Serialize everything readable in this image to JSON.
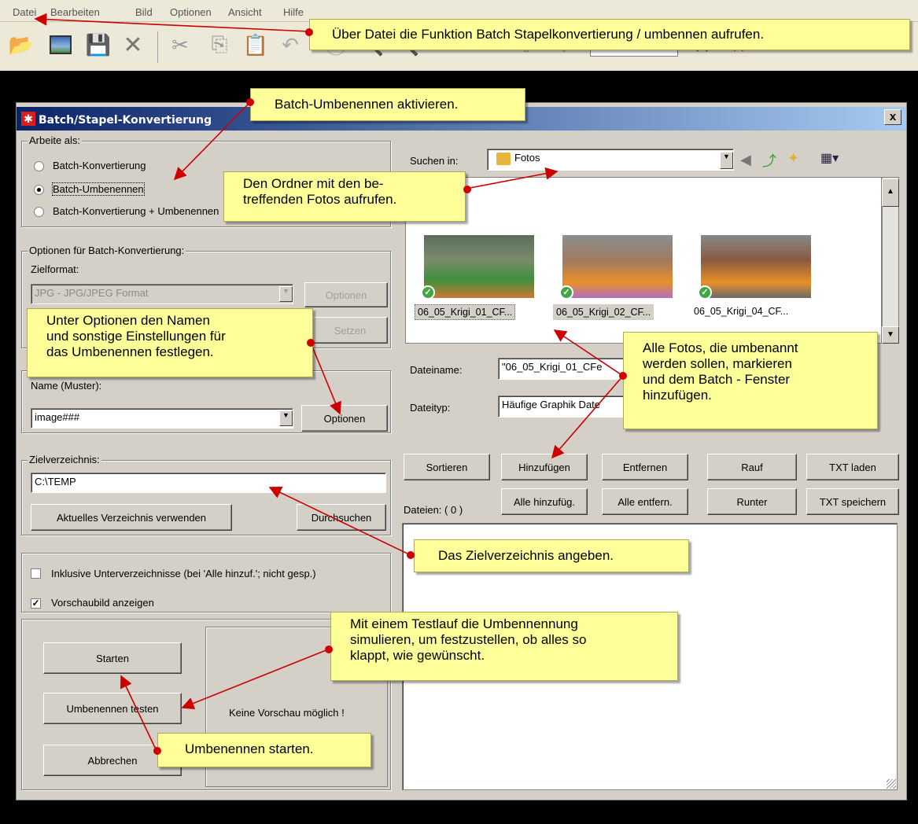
{
  "menu": [
    "Datei",
    "Bearbeiten",
    "Bild",
    "Optionen",
    "Ansicht",
    "Hilfe"
  ],
  "dialog": {
    "title": "Batch/Stapel-Konvertierung",
    "close_label": "x",
    "work_as": {
      "label": "Arbeite als:",
      "options": [
        "Batch-Konvertierung",
        "Batch-Umbenennen",
        "Batch-Konvertierung + Umbenennen"
      ],
      "selected": 1
    },
    "conversion": {
      "label": "Optionen für Batch-Konvertierung:",
      "format_label": "Zielformat:",
      "format_value": "JPG - JPG/JPEG Format",
      "options_button": "Optionen",
      "set_button": "Setzen"
    },
    "rename": {
      "name_label": "Name (Muster):",
      "name_value": "image###",
      "options_button": "Optionen"
    },
    "target": {
      "label": "Zielverzeichnis:",
      "value": "C:\\TEMP",
      "use_current_button": "Aktuelles Verzeichnis verwenden",
      "browse_button": "Durchsuchen"
    },
    "include_subdirs": "Inklusive Unterverzeichnisse (bei 'Alle hinzuf.'; nicht gesp.)",
    "show_preview": "Vorschaubild anzeigen",
    "start_button": "Starten",
    "test_button": "Umbenennen testen",
    "cancel_button": "Abbrechen",
    "preview_text": "Keine Vorschau möglich !",
    "search_in_label": "Suchen in:",
    "search_in_value": "Fotos",
    "thumbnails": [
      "06_05_Krigi_01_CF...",
      "06_05_Krigi_02_CF...",
      "06_05_Krigi_04_CF..."
    ],
    "filename_label": "Dateiname:",
    "filename_value": "\"06_05_Krigi_01_CFe",
    "filetype_label": "Dateityp:",
    "filetype_value": "Häufige Graphik Date",
    "buttons": {
      "sort": "Sortieren",
      "add": "Hinzufügen",
      "remove": "Entfernen",
      "up": "Rauf",
      "txt_load": "TXT laden",
      "add_all": "Alle hinzufüg.",
      "remove_all": "Alle entfern.",
      "down": "Runter",
      "txt_save": "TXT speichern"
    },
    "files_count": "Dateien: ( 0 )"
  },
  "callouts": {
    "menu_hint": "Über Datei die Funktion Batch Stapelkonvertierung / umbennen aufrufen.",
    "activate": "Batch-Umbenennen aktivieren.",
    "folder_line1": "Den Ordner mit den be-",
    "folder_line2": "treffenden Fotos aufrufen.",
    "options_line1": "Unter Optionen den Namen",
    "options_line2": "und sonstige Einstellungen für",
    "options_line3": "das Umbenennen festlegen.",
    "photos_line1": "Alle Fotos, die umbenannt",
    "photos_line2": "werden sollen, markieren",
    "photos_line3": "und dem Batch - Fenster",
    "photos_line4": "hinzufügen.",
    "target": "Das Zielverzeichnis angeben.",
    "test_line1": "Mit einem Testlauf die Umbennennung",
    "test_line2": "simulieren, um festzustellen, ob alles so",
    "test_line3": "klappt, wie gewünscht.",
    "start": "Umbenennen starten."
  },
  "colors": {
    "callout_bg": "#ffff99",
    "arrow": "#cc0000",
    "title_gradient_start": "#0a246a",
    "dialog_bg": "#d4d0c8"
  }
}
